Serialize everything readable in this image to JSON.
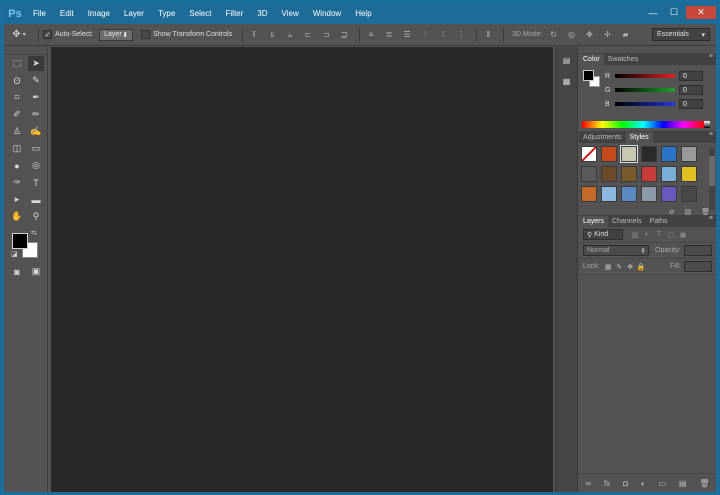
{
  "app": {
    "logo": "Ps"
  },
  "menu": [
    "File",
    "Edit",
    "Image",
    "Layer",
    "Type",
    "Select",
    "Filter",
    "3D",
    "View",
    "Window",
    "Help"
  ],
  "window_controls": {
    "minimize": "—",
    "maximize": "☐",
    "close": "✕"
  },
  "options": {
    "move_tool_glyph": "✥",
    "auto_select_label": "Auto-Select:",
    "auto_select_checked": true,
    "auto_select_target": "Layer",
    "show_transform_label": "Show Transform Controls",
    "mode_3d_label": "3D Mode:",
    "workspace": "Essentials"
  },
  "tools": [
    [
      "marquee-icon",
      "move-icon"
    ],
    [
      "lasso-icon",
      "quick-selection-icon"
    ],
    [
      "crop-icon",
      "eyedropper-icon"
    ],
    [
      "healing-brush-icon",
      "brush-icon"
    ],
    [
      "clone-stamp-icon",
      "history-brush-icon"
    ],
    [
      "eraser-icon",
      "gradient-icon"
    ],
    [
      "blur-icon",
      "dodge-icon"
    ],
    [
      "pen-icon",
      "type-icon"
    ],
    [
      "path-selection-icon",
      "rectangle-shape-icon"
    ],
    [
      "hand-icon",
      "zoom-icon"
    ]
  ],
  "tool_glyphs": [
    [
      "⬚",
      "➤"
    ],
    [
      "ʘ",
      "✎"
    ],
    [
      "⌗",
      "✒"
    ],
    [
      "✐",
      "✏"
    ],
    [
      "♙",
      "✍"
    ],
    [
      "◫",
      "▭"
    ],
    [
      "●",
      "◎"
    ],
    [
      "✑",
      "T"
    ],
    [
      "▸",
      "▬"
    ],
    [
      "✋",
      "⚲"
    ]
  ],
  "color_panel": {
    "tabs": [
      "Color",
      "Swatches"
    ],
    "rows": [
      {
        "label": "R",
        "value": "0",
        "color": "#e0241f"
      },
      {
        "label": "G",
        "value": "0",
        "color": "#1fa22e"
      },
      {
        "label": "B",
        "value": "0",
        "color": "#2038e0"
      }
    ]
  },
  "styles_panel": {
    "tabs": [
      "Adjustments",
      "Styles"
    ],
    "swatches": [
      "#e7e7e7",
      "#c64a1a",
      "#c8c8b0",
      "#2a2a2a",
      "#2c74c8",
      "#9a9a9a",
      "#5a5a5a",
      "#6a4a2a",
      "#7a5a2a",
      "#c73b3b",
      "#7ab0d8",
      "#e1c022",
      "#c66a28",
      "#8ab8e0",
      "#5a8ac0",
      "#8a9aa8",
      "#6a58c0",
      "#474747"
    ]
  },
  "layers_panel": {
    "tabs": [
      "Layers",
      "Channels",
      "Paths"
    ],
    "kind_label": "Kind",
    "blend_mode": "Normal",
    "opacity_label": "Opacity:",
    "lock_label": "Lock:",
    "fill_label": "Fill:"
  }
}
